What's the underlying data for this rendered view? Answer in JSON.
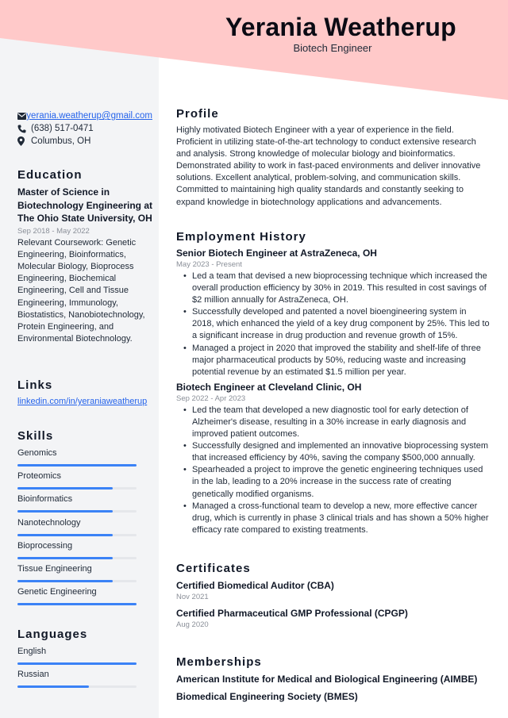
{
  "header": {
    "name": "Yerania Weatherup",
    "job_title": "Biotech Engineer",
    "accent_color": "#ffc9c9"
  },
  "contact": {
    "email": "yerania.weatherup@gmail.com",
    "phone": "(638) 517-0471",
    "location": "Columbus, OH",
    "icons": [
      "envelope-icon",
      "phone-icon",
      "map-pin-icon"
    ]
  },
  "education": {
    "heading": "Education",
    "degree": "Master of Science in Biotechnology Engineering at The Ohio State University, OH",
    "dates": "Sep 2018 - May 2022",
    "coursework": "Relevant Coursework: Genetic Engineering, Bioinformatics, Molecular Biology, Bioprocess Engineering, Biochemical Engineering, Cell and Tissue Engineering, Immunology, Biostatistics, Nanobiotechnology, Protein Engineering, and Environmental Biotechnology."
  },
  "links": {
    "heading": "Links",
    "items": [
      "linkedin.com/in/yeraniaweatherup"
    ]
  },
  "skills": {
    "heading": "Skills",
    "bar_color": "#3b82f6",
    "items": [
      {
        "label": "Genomics",
        "level": 1.0
      },
      {
        "label": "Proteomics",
        "level": 0.8
      },
      {
        "label": "Bioinformatics",
        "level": 0.8
      },
      {
        "label": "Nanotechnology",
        "level": 0.8
      },
      {
        "label": "Bioprocessing",
        "level": 0.8
      },
      {
        "label": "Tissue Engineering",
        "level": 0.8
      },
      {
        "label": "Genetic Engineering",
        "level": 1.0
      }
    ]
  },
  "languages": {
    "heading": "Languages",
    "items": [
      {
        "label": "English",
        "level": 1.0
      },
      {
        "label": "Russian",
        "level": 0.6
      }
    ]
  },
  "profile": {
    "heading": "Profile",
    "text": "Highly motivated Biotech Engineer with a year of experience in the field. Proficient in utilizing state-of-the-art technology to conduct extensive research and analysis. Strong knowledge of molecular biology and bioinformatics. Demonstrated ability to work in fast-paced environments and deliver innovative solutions. Excellent analytical, problem-solving, and communication skills. Committed to maintaining high quality standards and constantly seeking to expand knowledge in biotechnology applications and advancements."
  },
  "employment": {
    "heading": "Employment History",
    "jobs": [
      {
        "title": "Senior Biotech Engineer at AstraZeneca, OH",
        "dates": "May 2023 - Present",
        "bullets": [
          "Led a team that devised a new bioprocessing technique which increased the overall production efficiency by 30% in 2019. This resulted in cost savings of $2 million annually for AstraZeneca, OH.",
          "Successfully developed and patented a novel bioengineering system in 2018, which enhanced the yield of a key drug component by 25%. This led to a significant increase in drug production and revenue growth of 15%.",
          "Managed a project in 2020 that improved the stability and shelf-life of three major pharmaceutical products by 50%, reducing waste and increasing potential revenue by an estimated $1.5 million per year."
        ]
      },
      {
        "title": "Biotech Engineer at Cleveland Clinic, OH",
        "dates": "Sep 2022 - Apr 2023",
        "bullets": [
          "Led the team that developed a new diagnostic tool for early detection of Alzheimer's disease, resulting in a 30% increase in early diagnosis and improved patient outcomes.",
          "Successfully designed and implemented an innovative bioprocessing system that increased efficiency by 40%, saving the company $500,000 annually.",
          "Spearheaded a project to improve the genetic engineering techniques used in the lab, leading to a 20% increase in the success rate of creating genetically modified organisms.",
          "Managed a cross-functional team to develop a new, more effective cancer drug, which is currently in phase 3 clinical trials and has shown a 50% higher efficacy rate compared to existing treatments."
        ]
      }
    ]
  },
  "certificates": {
    "heading": "Certificates",
    "items": [
      {
        "title": "Certified Biomedical Auditor (CBA)",
        "date": "Nov 2021"
      },
      {
        "title": "Certified Pharmaceutical GMP Professional (CPGP)",
        "date": "Aug 2020"
      }
    ]
  },
  "memberships": {
    "heading": "Memberships",
    "items": [
      "American Institute for Medical and Biological Engineering (AIMBE)",
      "Biomedical Engineering Society (BMES)"
    ]
  }
}
